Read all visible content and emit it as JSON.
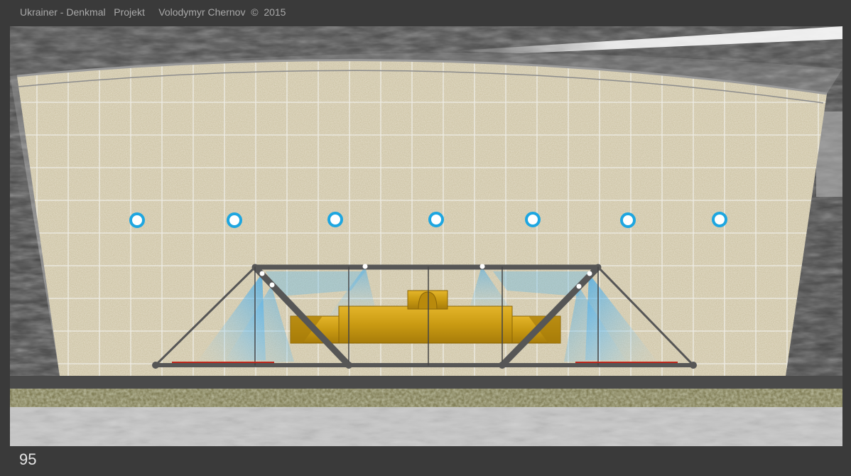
{
  "header": {
    "caption": "Ukrainer - Denkmal   Projekt     Volodymyr Chernov  ©  2015"
  },
  "footer": {
    "page_number": "95"
  },
  "colors": {
    "frame": "#3a3a3a",
    "wall_stone": "#c9bf9f",
    "grid_lines": "#f2f2ee",
    "light_points": "#1ea6e0",
    "steel_frame": "#565656",
    "monument_gold": "#c99a12",
    "light_rays": "#5ab8ee",
    "red_strip": "#c0261a",
    "pavement": "#c6c6c6",
    "hedge": "#7d7a52"
  }
}
